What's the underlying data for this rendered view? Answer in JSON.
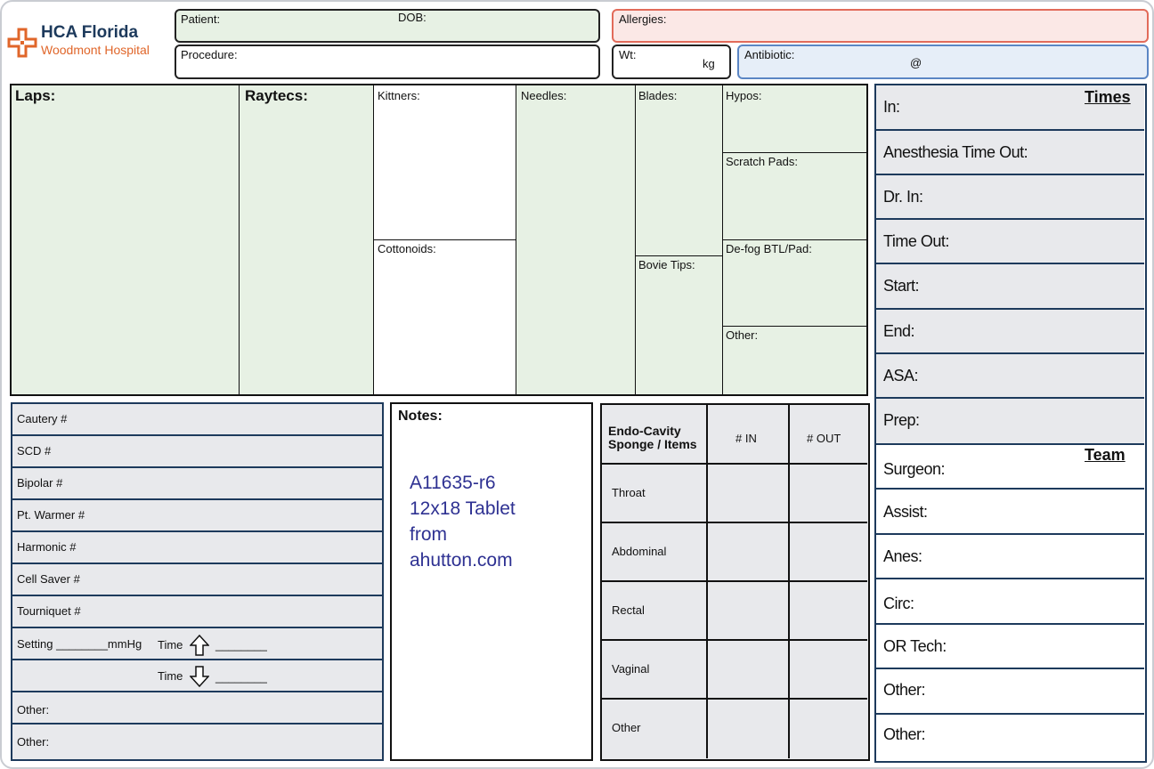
{
  "header": {
    "logo_name": "HCA Florida",
    "logo_sub": "Woodmont Hospital",
    "patient_label": "Patient:",
    "dob_label": "DOB:",
    "procedure_label": "Procedure:",
    "allergies_label": "Allergies:",
    "wt_label": "Wt:",
    "wt_unit": "kg",
    "antibiotic_label": "Antibiotic:",
    "antibiotic_at": "@"
  },
  "counts": {
    "laps": "Laps:",
    "raytecs": "Raytecs:",
    "kittners": "Kittners:",
    "cottonoids": "Cottonoids:",
    "needles": "Needles:",
    "blades": "Blades:",
    "bovie_tips": "Bovie Tips:",
    "hypos": "Hypos:",
    "scratch_pads": "Scratch Pads:",
    "defog": "De-fog BTL/Pad:",
    "other": "Other:"
  },
  "equipment": {
    "rows": [
      "Cautery #",
      "SCD #",
      "Bipolar #",
      "Pt. Warmer #",
      "Harmonic #",
      "Cell Saver #",
      "Tourniquet #"
    ],
    "setting": "Setting ________mmHg",
    "time_label": "Time",
    "time_blank": "________",
    "other1": "Other:",
    "other2": "Other:"
  },
  "notes": {
    "title": "Notes:",
    "line1": "A11635-r6",
    "line2": "12x18 Tablet",
    "line3": "from",
    "line4": "ahutton.com"
  },
  "endo": {
    "header1": "Endo-Cavity",
    "header2": "Sponge / Items",
    "col_in": "# IN",
    "col_out": "# OUT",
    "rows": [
      "Throat",
      "Abdominal",
      "Rectal",
      "Vaginal",
      "Other"
    ]
  },
  "times": {
    "title": "Times",
    "rows": [
      "In:",
      "Anesthesia Time Out:",
      "Dr. In:",
      "Time Out:",
      "Start:",
      "End:",
      "ASA:",
      "Prep:"
    ]
  },
  "team": {
    "title": "Team",
    "rows": [
      "Surgeon:",
      "Assist:",
      "Anes:",
      "Circ:",
      "OR Tech:",
      "Other:",
      "Other:"
    ]
  },
  "colors": {
    "brand_blue": "#1d3a5c",
    "brand_orange": "#e0662a",
    "green_fill": "#e7f1e4",
    "grey_fill": "#e8e9ec",
    "notes_text": "#2e3192"
  }
}
